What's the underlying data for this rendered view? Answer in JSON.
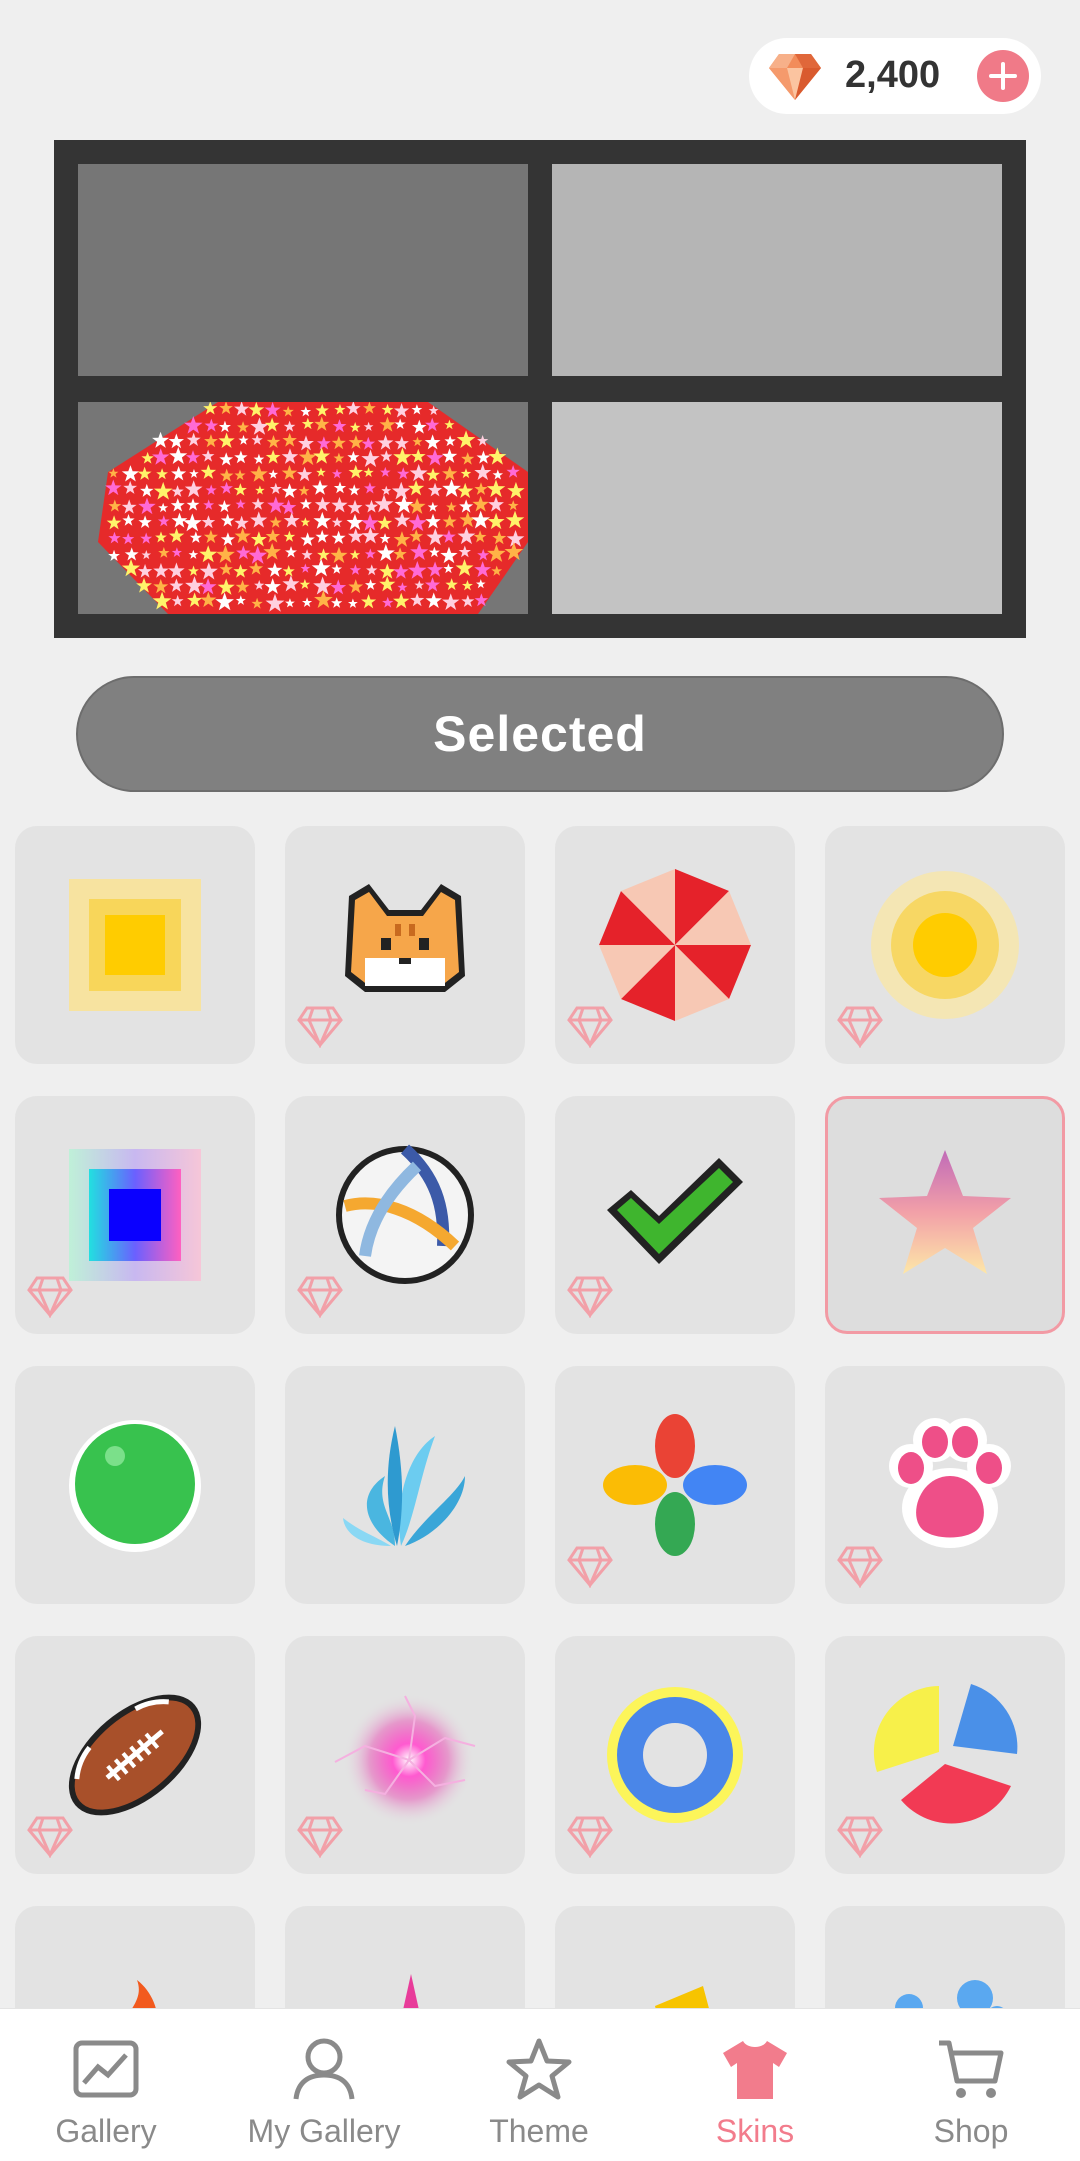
{
  "currency": {
    "amount": "2,400",
    "icon": "gem-icon",
    "accent": "#f07a88"
  },
  "preview": {
    "selected_label": "Selected"
  },
  "skins": [
    {
      "name": "yellow-square"
    },
    {
      "name": "pixel-cat"
    },
    {
      "name": "red-umbrella"
    },
    {
      "name": "yellow-dot"
    },
    {
      "name": "rainbow-square"
    },
    {
      "name": "volleyball"
    },
    {
      "name": "pixel-check"
    },
    {
      "name": "gradient-star",
      "selected": true
    },
    {
      "name": "green-ball"
    },
    {
      "name": "water-splash"
    },
    {
      "name": "color-petals"
    },
    {
      "name": "paw-print"
    },
    {
      "name": "football"
    },
    {
      "name": "pink-lightning"
    },
    {
      "name": "blue-ring"
    },
    {
      "name": "pie-slices"
    }
  ],
  "nav": {
    "items": [
      {
        "label": "Gallery",
        "icon": "gallery-icon"
      },
      {
        "label": "My Gallery",
        "icon": "person-icon"
      },
      {
        "label": "Theme",
        "icon": "star-icon"
      },
      {
        "label": "Skins",
        "icon": "shirt-icon",
        "active": true
      },
      {
        "label": "Shop",
        "icon": "cart-icon"
      }
    ],
    "active_color": "#f27c8c"
  }
}
